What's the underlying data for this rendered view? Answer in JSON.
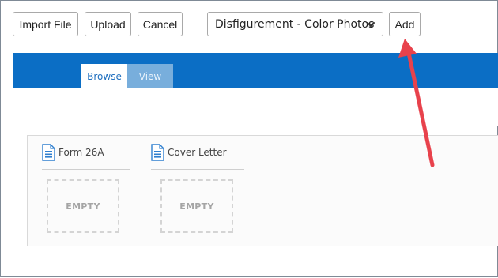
{
  "toolbar": {
    "import_label": "Import File",
    "upload_label": "Upload",
    "cancel_label": "Cancel",
    "add_label": "Add",
    "document_type": {
      "selected": "Disfigurement - Color Photos"
    }
  },
  "tabs": [
    {
      "label": "Browse",
      "active": true
    },
    {
      "label": "View",
      "active": false
    }
  ],
  "documents": [
    {
      "title": "Form 26A",
      "placeholder": "EMPTY",
      "icon": "document-icon"
    },
    {
      "title": "Cover Letter",
      "placeholder": "EMPTY",
      "icon": "document-icon"
    }
  ],
  "colors": {
    "header_bar": "#0b6ec5",
    "active_tab_text": "#1f6fbf",
    "inactive_tab_bg": "#78aedc",
    "annotation_arrow": "#e8424c",
    "doc_icon": "#2f7fcf"
  }
}
